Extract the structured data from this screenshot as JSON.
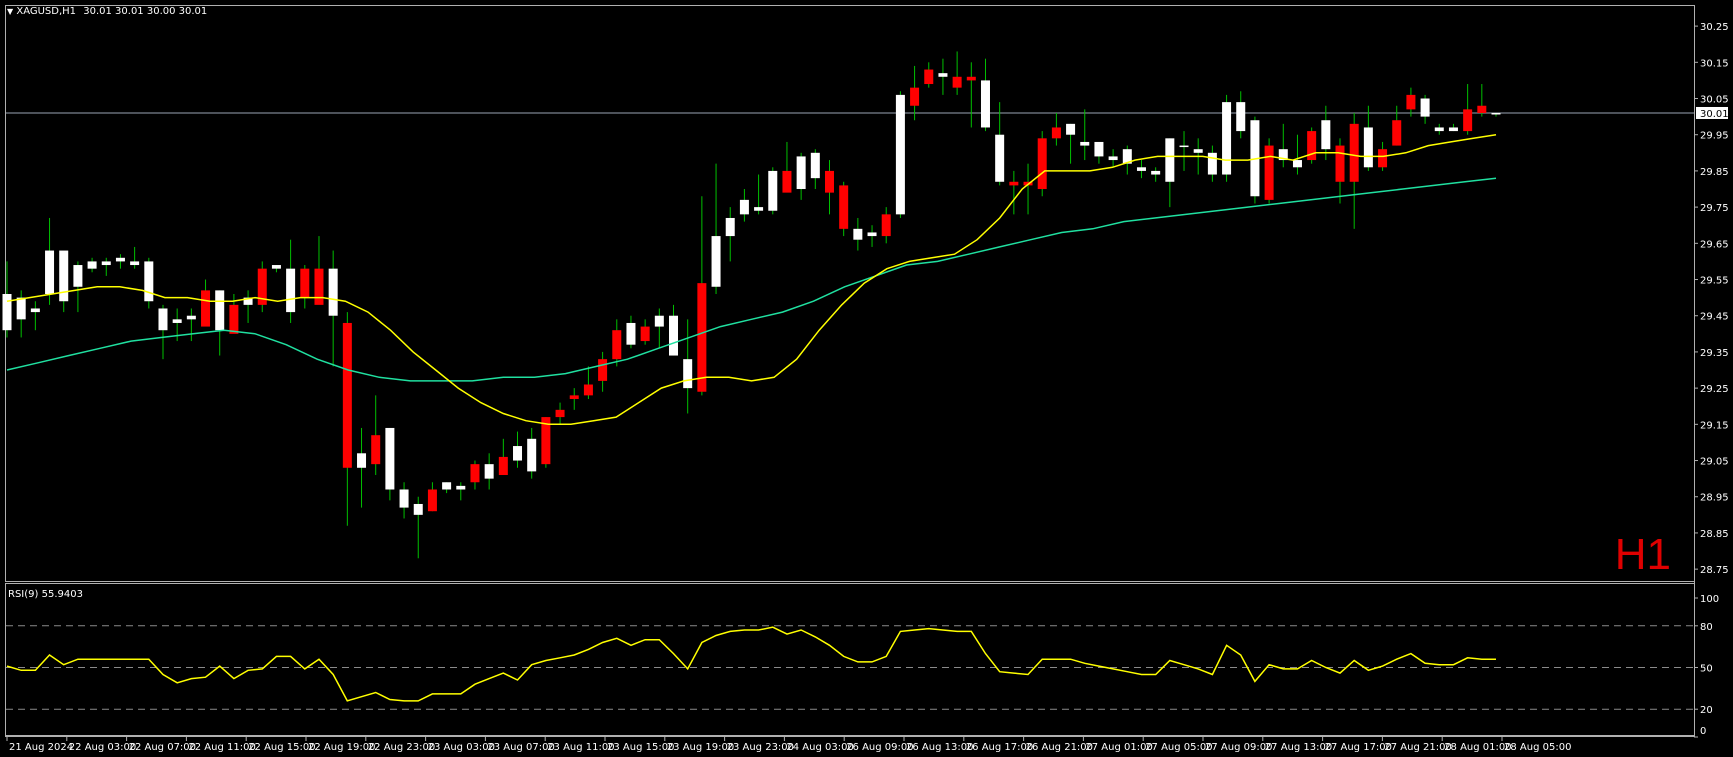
{
  "header": {
    "symbol_label": "XAGUSD,H1",
    "ohlc_label": "30.01 30.01 30.00 30.01"
  },
  "timeframe_badge": "H1",
  "rsi_panel": {
    "label": "RSI(9) 55.9403",
    "levels": [
      20,
      50,
      80
    ],
    "axis_ticks": [
      "100",
      "80",
      "50",
      "20",
      "0"
    ]
  },
  "colors": {
    "background": "#000000",
    "bull_candle": "#ffffff",
    "bear_candle": "#ff0000",
    "wick": "#00c000",
    "ma_fast": "#ffff00",
    "ma_slow": "#20e0a0",
    "rsi_line": "#ffff00",
    "current_price_line": "#9aa5b4",
    "timeframe_badge": "#e00000"
  },
  "chart_data": [
    {
      "type": "candlestick",
      "title": "XAGUSD,H1",
      "price_axis_ticks": [
        "30.25",
        "30.15",
        "30.05",
        "29.95",
        "29.85",
        "29.75",
        "29.65",
        "29.55",
        "29.45",
        "29.35",
        "29.25",
        "29.15",
        "29.05",
        "28.95",
        "28.85",
        "28.75"
      ],
      "ylim": [
        28.72,
        30.3
      ],
      "current_price": "30.01",
      "time_axis_labels": [
        "21 Aug 2024",
        "22 Aug 03:00",
        "22 Aug 07:00",
        "22 Aug 11:00",
        "22 Aug 15:00",
        "22 Aug 19:00",
        "22 Aug 23:00",
        "23 Aug 03:00",
        "23 Aug 07:00",
        "23 Aug 11:00",
        "23 Aug 15:00",
        "23 Aug 19:00",
        "23 Aug 23:00",
        "24 Aug 03:00",
        "26 Aug 09:00",
        "26 Aug 13:00",
        "26 Aug 17:00",
        "26 Aug 21:00",
        "27 Aug 01:00",
        "27 Aug 05:00",
        "27 Aug 09:00",
        "27 Aug 13:00",
        "27 Aug 17:00",
        "27 Aug 21:00",
        "28 Aug 01:00",
        "28 Aug 05:00"
      ],
      "candles": [
        {
          "o": 29.41,
          "h": 29.6,
          "l": 29.39,
          "c": 29.51
        },
        {
          "o": 29.44,
          "h": 29.52,
          "l": 29.39,
          "c": 29.5
        },
        {
          "o": 29.46,
          "h": 29.49,
          "l": 29.41,
          "c": 29.47
        },
        {
          "o": 29.51,
          "h": 29.72,
          "l": 29.48,
          "c": 29.63
        },
        {
          "o": 29.49,
          "h": 29.62,
          "l": 29.46,
          "c": 29.63
        },
        {
          "o": 29.53,
          "h": 29.6,
          "l": 29.46,
          "c": 29.59
        },
        {
          "o": 29.58,
          "h": 29.61,
          "l": 29.57,
          "c": 29.6
        },
        {
          "o": 29.59,
          "h": 29.61,
          "l": 29.56,
          "c": 29.6
        },
        {
          "o": 29.6,
          "h": 29.62,
          "l": 29.58,
          "c": 29.61
        },
        {
          "o": 29.59,
          "h": 29.64,
          "l": 29.58,
          "c": 29.6
        },
        {
          "o": 29.49,
          "h": 29.61,
          "l": 29.47,
          "c": 29.6
        },
        {
          "o": 29.41,
          "h": 29.48,
          "l": 29.33,
          "c": 29.47
        },
        {
          "o": 29.43,
          "h": 29.47,
          "l": 29.38,
          "c": 29.44
        },
        {
          "o": 29.44,
          "h": 29.47,
          "l": 29.38,
          "c": 29.45
        },
        {
          "o": 29.52,
          "h": 29.55,
          "l": 29.44,
          "c": 29.42
        },
        {
          "o": 29.41,
          "h": 29.52,
          "l": 29.34,
          "c": 29.52
        },
        {
          "o": 29.48,
          "h": 29.51,
          "l": 29.42,
          "c": 29.4
        },
        {
          "o": 29.48,
          "h": 29.52,
          "l": 29.43,
          "c": 29.5
        },
        {
          "o": 29.58,
          "h": 29.6,
          "l": 29.46,
          "c": 29.48
        },
        {
          "o": 29.58,
          "h": 29.59,
          "l": 29.57,
          "c": 29.59
        },
        {
          "o": 29.46,
          "h": 29.66,
          "l": 29.43,
          "c": 29.58
        },
        {
          "o": 29.58,
          "h": 29.59,
          "l": 29.47,
          "c": 29.5
        },
        {
          "o": 29.58,
          "h": 29.67,
          "l": 29.49,
          "c": 29.48
        },
        {
          "o": 29.45,
          "h": 29.63,
          "l": 29.31,
          "c": 29.58
        },
        {
          "o": 29.43,
          "h": 29.46,
          "l": 28.87,
          "c": 29.03
        },
        {
          "o": 29.03,
          "h": 29.14,
          "l": 28.92,
          "c": 29.07
        },
        {
          "o": 29.12,
          "h": 29.23,
          "l": 29.01,
          "c": 29.04
        },
        {
          "o": 28.97,
          "h": 29.14,
          "l": 28.94,
          "c": 29.14
        },
        {
          "o": 28.92,
          "h": 28.99,
          "l": 28.89,
          "c": 28.97
        },
        {
          "o": 28.9,
          "h": 28.95,
          "l": 28.78,
          "c": 28.93
        },
        {
          "o": 28.97,
          "h": 28.99,
          "l": 28.91,
          "c": 28.91
        },
        {
          "o": 28.97,
          "h": 28.99,
          "l": 28.96,
          "c": 28.99
        },
        {
          "o": 28.97,
          "h": 28.99,
          "l": 28.94,
          "c": 28.98
        },
        {
          "o": 29.04,
          "h": 29.05,
          "l": 28.97,
          "c": 28.99
        },
        {
          "o": 29.0,
          "h": 29.07,
          "l": 28.97,
          "c": 29.04
        },
        {
          "o": 29.06,
          "h": 29.11,
          "l": 29.02,
          "c": 29.01
        },
        {
          "o": 29.05,
          "h": 29.13,
          "l": 29.03,
          "c": 29.09
        },
        {
          "o": 29.02,
          "h": 29.14,
          "l": 29.0,
          "c": 29.11
        },
        {
          "o": 29.17,
          "h": 29.17,
          "l": 29.03,
          "c": 29.04
        },
        {
          "o": 29.19,
          "h": 29.21,
          "l": 29.15,
          "c": 29.17
        },
        {
          "o": 29.23,
          "h": 29.25,
          "l": 29.19,
          "c": 29.22
        },
        {
          "o": 29.26,
          "h": 29.31,
          "l": 29.22,
          "c": 29.23
        },
        {
          "o": 29.33,
          "h": 29.35,
          "l": 29.24,
          "c": 29.27
        },
        {
          "o": 29.41,
          "h": 29.44,
          "l": 29.31,
          "c": 29.33
        },
        {
          "o": 29.37,
          "h": 29.45,
          "l": 29.36,
          "c": 29.43
        },
        {
          "o": 29.42,
          "h": 29.44,
          "l": 29.37,
          "c": 29.38
        },
        {
          "o": 29.42,
          "h": 29.47,
          "l": 29.36,
          "c": 29.45
        },
        {
          "o": 29.34,
          "h": 29.48,
          "l": 29.34,
          "c": 29.45
        },
        {
          "o": 29.25,
          "h": 29.44,
          "l": 29.18,
          "c": 29.33
        },
        {
          "o": 29.54,
          "h": 29.78,
          "l": 29.23,
          "c": 29.24
        },
        {
          "o": 29.53,
          "h": 29.87,
          "l": 29.51,
          "c": 29.67
        },
        {
          "o": 29.67,
          "h": 29.75,
          "l": 29.6,
          "c": 29.72
        },
        {
          "o": 29.73,
          "h": 29.8,
          "l": 29.71,
          "c": 29.77
        },
        {
          "o": 29.74,
          "h": 29.84,
          "l": 29.73,
          "c": 29.75
        },
        {
          "o": 29.74,
          "h": 29.86,
          "l": 29.73,
          "c": 29.85
        },
        {
          "o": 29.85,
          "h": 29.93,
          "l": 29.8,
          "c": 29.79
        },
        {
          "o": 29.8,
          "h": 29.9,
          "l": 29.77,
          "c": 29.89
        },
        {
          "o": 29.83,
          "h": 29.91,
          "l": 29.8,
          "c": 29.9
        },
        {
          "o": 29.85,
          "h": 29.88,
          "l": 29.73,
          "c": 29.79
        },
        {
          "o": 29.81,
          "h": 29.82,
          "l": 29.67,
          "c": 29.69
        },
        {
          "o": 29.66,
          "h": 29.72,
          "l": 29.63,
          "c": 29.69
        },
        {
          "o": 29.67,
          "h": 29.7,
          "l": 29.64,
          "c": 29.68
        },
        {
          "o": 29.73,
          "h": 29.75,
          "l": 29.65,
          "c": 29.67
        },
        {
          "o": 29.73,
          "h": 30.07,
          "l": 29.72,
          "c": 30.06
        },
        {
          "o": 30.08,
          "h": 30.14,
          "l": 29.99,
          "c": 30.03
        },
        {
          "o": 30.13,
          "h": 30.15,
          "l": 30.08,
          "c": 30.09
        },
        {
          "o": 30.11,
          "h": 30.16,
          "l": 30.06,
          "c": 30.12
        },
        {
          "o": 30.11,
          "h": 30.18,
          "l": 30.06,
          "c": 30.08
        },
        {
          "o": 30.11,
          "h": 30.15,
          "l": 29.97,
          "c": 30.1
        },
        {
          "o": 29.97,
          "h": 30.16,
          "l": 29.96,
          "c": 30.1
        },
        {
          "o": 29.82,
          "h": 30.04,
          "l": 29.81,
          "c": 29.95
        },
        {
          "o": 29.82,
          "h": 29.85,
          "l": 29.73,
          "c": 29.81
        },
        {
          "o": 29.82,
          "h": 29.87,
          "l": 29.73,
          "c": 29.81
        },
        {
          "o": 29.94,
          "h": 29.96,
          "l": 29.78,
          "c": 29.8
        },
        {
          "o": 29.97,
          "h": 30.01,
          "l": 29.92,
          "c": 29.94
        },
        {
          "o": 29.95,
          "h": 29.98,
          "l": 29.87,
          "c": 29.98
        },
        {
          "o": 29.92,
          "h": 30.02,
          "l": 29.88,
          "c": 29.93
        },
        {
          "o": 29.89,
          "h": 29.93,
          "l": 29.87,
          "c": 29.93
        },
        {
          "o": 29.88,
          "h": 29.91,
          "l": 29.86,
          "c": 29.89
        },
        {
          "o": 29.87,
          "h": 29.92,
          "l": 29.84,
          "c": 29.91
        },
        {
          "o": 29.85,
          "h": 29.88,
          "l": 29.83,
          "c": 29.86
        },
        {
          "o": 29.84,
          "h": 29.86,
          "l": 29.82,
          "c": 29.85
        },
        {
          "o": 29.82,
          "h": 29.94,
          "l": 29.75,
          "c": 29.94
        },
        {
          "o": 29.92,
          "h": 29.96,
          "l": 29.85,
          "c": 29.92
        },
        {
          "o": 29.9,
          "h": 29.94,
          "l": 29.84,
          "c": 29.91
        },
        {
          "o": 29.84,
          "h": 29.92,
          "l": 29.82,
          "c": 29.9
        },
        {
          "o": 29.84,
          "h": 30.06,
          "l": 29.82,
          "c": 30.04
        },
        {
          "o": 29.96,
          "h": 30.07,
          "l": 29.94,
          "c": 30.04
        },
        {
          "o": 29.78,
          "h": 30.0,
          "l": 29.76,
          "c": 29.99
        },
        {
          "o": 29.92,
          "h": 29.94,
          "l": 29.76,
          "c": 29.77
        },
        {
          "o": 29.88,
          "h": 29.98,
          "l": 29.86,
          "c": 29.91
        },
        {
          "o": 29.86,
          "h": 29.95,
          "l": 29.84,
          "c": 29.88
        },
        {
          "o": 29.96,
          "h": 29.97,
          "l": 29.87,
          "c": 29.88
        },
        {
          "o": 29.91,
          "h": 30.03,
          "l": 29.88,
          "c": 29.99
        },
        {
          "o": 29.92,
          "h": 29.94,
          "l": 29.76,
          "c": 29.82
        },
        {
          "o": 29.98,
          "h": 30.01,
          "l": 29.69,
          "c": 29.82
        },
        {
          "o": 29.86,
          "h": 30.03,
          "l": 29.85,
          "c": 29.97
        },
        {
          "o": 29.91,
          "h": 29.93,
          "l": 29.85,
          "c": 29.86
        },
        {
          "o": 29.99,
          "h": 30.03,
          "l": 29.92,
          "c": 29.92
        },
        {
          "o": 30.06,
          "h": 30.08,
          "l": 30.0,
          "c": 30.02
        },
        {
          "o": 30.0,
          "h": 30.06,
          "l": 29.98,
          "c": 30.05
        },
        {
          "o": 29.96,
          "h": 29.98,
          "l": 29.95,
          "c": 29.97
        },
        {
          "o": 29.96,
          "h": 29.98,
          "l": 29.96,
          "c": 29.97
        },
        {
          "o": 30.02,
          "h": 30.09,
          "l": 29.95,
          "c": 29.96
        },
        {
          "o": 30.03,
          "h": 30.09,
          "l": 30.0,
          "c": 30.01
        },
        {
          "o": 30.01,
          "h": 30.01,
          "l": 30.0,
          "c": 30.01
        }
      ],
      "ma_fast": [
        29.49,
        29.5,
        29.51,
        29.52,
        29.53,
        29.53,
        29.52,
        29.5,
        29.5,
        29.49,
        29.49,
        29.5,
        29.49,
        29.5,
        29.5,
        29.49,
        29.46,
        29.41,
        29.35,
        29.3,
        29.25,
        29.21,
        29.18,
        29.16,
        29.15,
        29.15,
        29.16,
        29.17,
        29.21,
        29.25,
        29.27,
        29.28,
        29.28,
        29.27,
        29.28,
        29.33,
        29.41,
        29.48,
        29.54,
        29.58,
        29.6,
        29.61,
        29.62,
        29.66,
        29.72,
        29.8,
        29.85,
        29.85,
        29.85,
        29.86,
        29.88,
        29.89,
        29.89,
        29.89,
        29.88,
        29.88,
        29.89,
        29.88,
        29.9,
        29.9,
        29.89,
        29.89,
        29.9,
        29.92,
        29.93,
        29.94,
        29.95
      ],
      "ma_slow": [
        29.3,
        29.32,
        29.34,
        29.36,
        29.38,
        29.39,
        29.4,
        29.41,
        29.4,
        29.37,
        29.33,
        29.3,
        29.28,
        29.27,
        29.27,
        29.27,
        29.28,
        29.28,
        29.29,
        29.31,
        29.33,
        29.36,
        29.39,
        29.42,
        29.44,
        29.46,
        29.49,
        29.53,
        29.56,
        29.59,
        29.6,
        29.62,
        29.64,
        29.66,
        29.68,
        29.69,
        29.71,
        29.72,
        29.73,
        29.74,
        29.75,
        29.76,
        29.77,
        29.78,
        29.79,
        29.8,
        29.81,
        29.82,
        29.83
      ]
    },
    {
      "type": "line",
      "title": "RSI(9) 55.9403",
      "ylim": [
        0,
        100
      ],
      "levels": [
        20,
        50,
        80
      ],
      "values": [
        51,
        48,
        48,
        59,
        52,
        56,
        56,
        56,
        56,
        56,
        56,
        45,
        39,
        42,
        43,
        51,
        42,
        48,
        49,
        58,
        58,
        49,
        56,
        45,
        26,
        29,
        32,
        27,
        26,
        26,
        31,
        31,
        31,
        38,
        42,
        46,
        41,
        52,
        55,
        57,
        59,
        63,
        68,
        71,
        66,
        70,
        70,
        60,
        49,
        68,
        73,
        76,
        77,
        77,
        79,
        74,
        77,
        72,
        66,
        58,
        54,
        54,
        58,
        76,
        77,
        78,
        77,
        76,
        76,
        60,
        47,
        46,
        45,
        56,
        56,
        56,
        53,
        51,
        49,
        47,
        45,
        45,
        55,
        52,
        49,
        45,
        66,
        59,
        40,
        52,
        49,
        49,
        55,
        50,
        46,
        55,
        48,
        51,
        56,
        60,
        53,
        52,
        52,
        57,
        56,
        56
      ]
    }
  ]
}
